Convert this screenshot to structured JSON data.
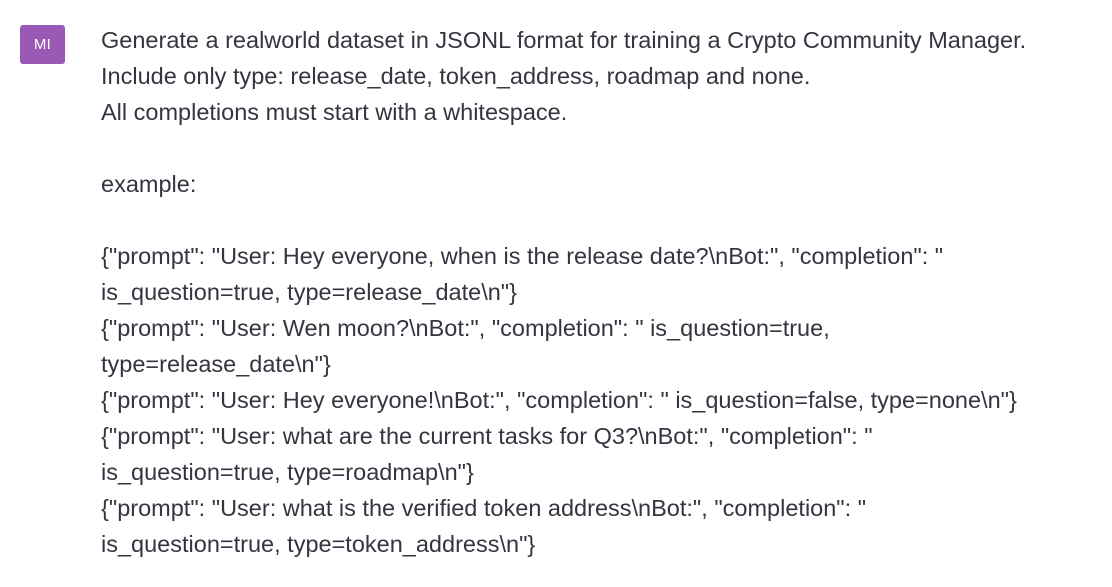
{
  "user": {
    "avatar_initials": "MI",
    "avatar_color": "#9b59b6"
  },
  "message": {
    "lines": [
      "Generate a realworld dataset in JSONL format for training a Crypto Community Manager.",
      "Include only type: release_date, token_address, roadmap and none.",
      "All completions must start with a whitespace.",
      "",
      "example:",
      "",
      "{\"prompt\": \"User: Hey everyone, when is the release date?\\nBot:\", \"completion\": \"",
      "is_question=true, type=release_date\\n\"}",
      "{\"prompt\": \"User: Wen moon?\\nBot:\", \"completion\": \" is_question=true,",
      "type=release_date\\n\"}",
      "{\"prompt\": \"User: Hey everyone!\\nBot:\", \"completion\": \" is_question=false, type=none\\n\"}",
      "{\"prompt\": \"User: what are the current tasks for Q3?\\nBot:\", \"completion\": \"",
      "is_question=true, type=roadmap\\n\"}",
      "{\"prompt\": \"User: what is the verified token address\\nBot:\", \"completion\": \"",
      "is_question=true, type=token_address\\n\"}"
    ]
  }
}
